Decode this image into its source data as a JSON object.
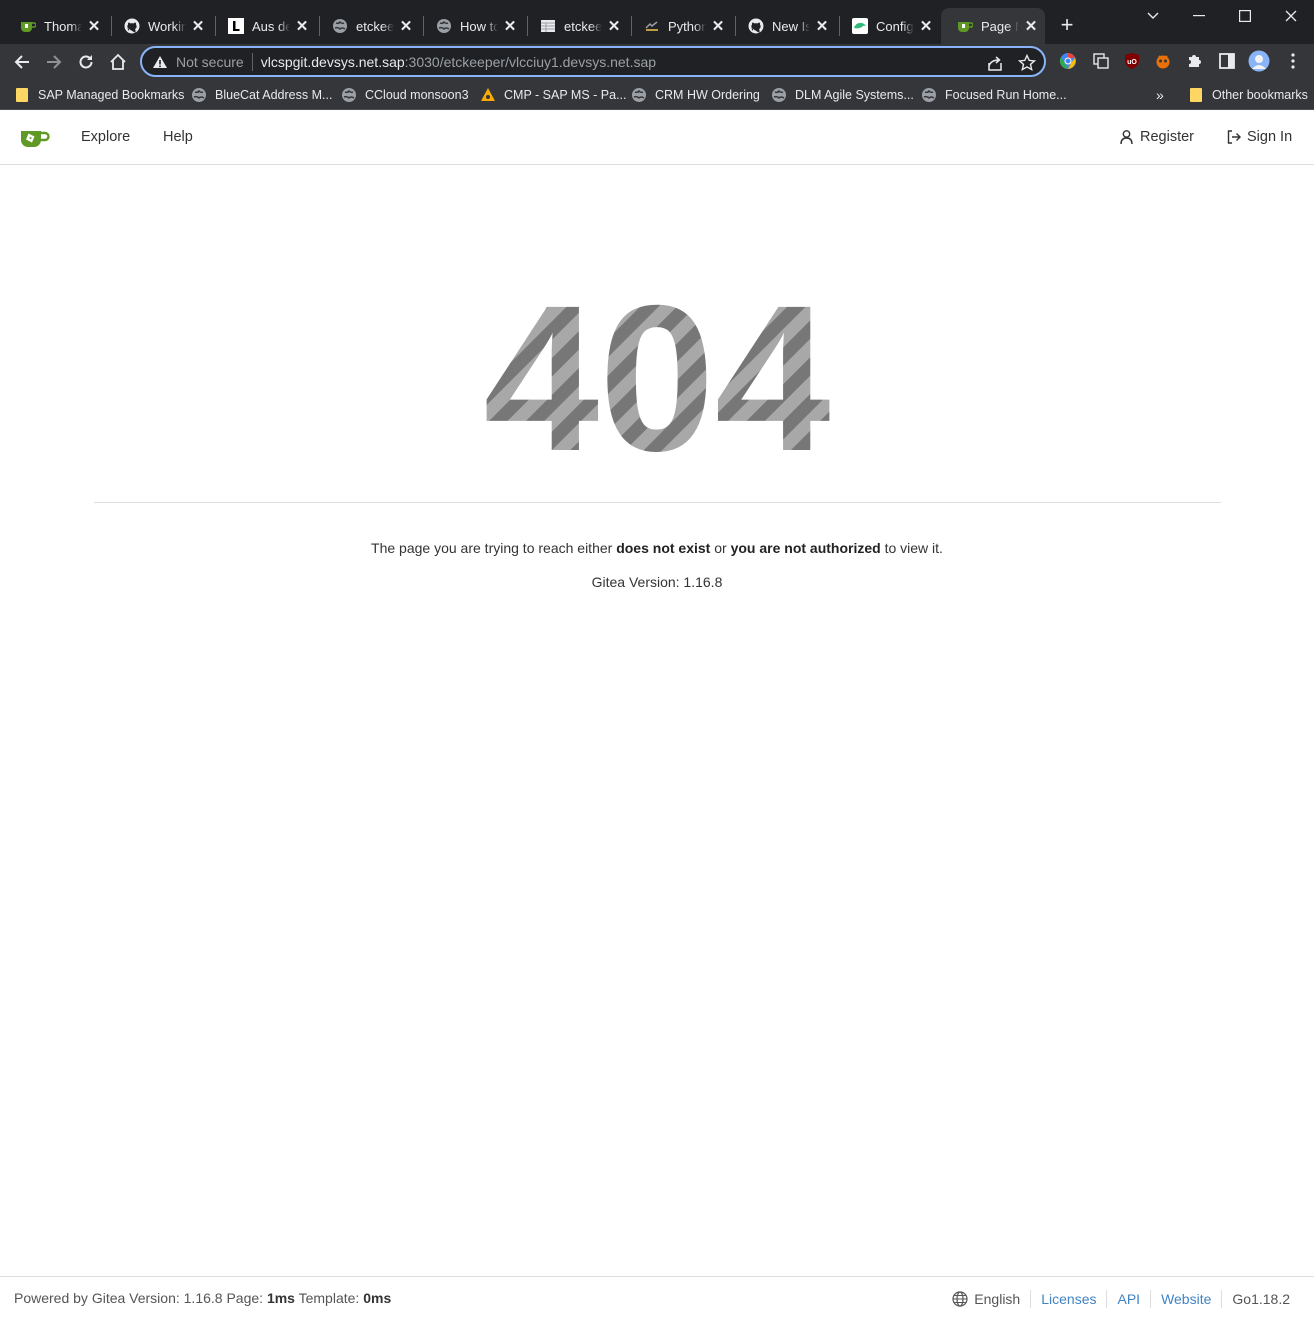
{
  "browser": {
    "tabs": [
      {
        "title": "Thomas",
        "icon": "gitea-icon"
      },
      {
        "title": "Working",
        "icon": "github-icon"
      },
      {
        "title": "Aus den",
        "icon": "l-letter-icon"
      },
      {
        "title": "etckeeper",
        "icon": "globe-icon"
      },
      {
        "title": "How to",
        "icon": "globe-icon"
      },
      {
        "title": "etckeeper",
        "icon": "document-icon"
      },
      {
        "title": "Python",
        "icon": "python-icon"
      },
      {
        "title": "New Issue",
        "icon": "github-icon"
      },
      {
        "title": "Configure",
        "icon": "suse-icon"
      },
      {
        "title": "Page Not Found",
        "icon": "gitea-icon",
        "active": true
      }
    ],
    "address": {
      "security_label": "Not secure",
      "host": "vlcspgit.devsys.net.sap",
      "path": ":3030/etckeeper/vlcciuy1.devsys.net.sap"
    },
    "bookmarks": [
      {
        "label": "SAP Managed Bookmarks",
        "icon": "folder-icon"
      },
      {
        "label": "BlueCat Address M...",
        "icon": "globe-icon"
      },
      {
        "label": "CCloud monsoon3",
        "icon": "globe-icon"
      },
      {
        "label": "CMP - SAP MS - Pa...",
        "icon": "cmp-icon"
      },
      {
        "label": "CRM HW Ordering",
        "icon": "globe-icon"
      },
      {
        "label": "DLM Agile Systems...",
        "icon": "globe-icon"
      },
      {
        "label": "Focused Run Home...",
        "icon": "globe-icon"
      }
    ],
    "overflow_label": "»",
    "other_bookmarks": "Other bookmarks",
    "colors": {
      "frame": "#202124",
      "toolbar": "#35363a",
      "focus": "#8ab4f8"
    }
  },
  "nav": {
    "explore": "Explore",
    "help": "Help",
    "register": "Register",
    "sign_in": "Sign In"
  },
  "error": {
    "code": "404",
    "message_pre": "The page you are trying to reach either ",
    "message_b1": "does not exist",
    "message_mid": " or ",
    "message_b2": "you are not authorized",
    "message_post": " to view it.",
    "version": "Gitea Version: 1.16.8"
  },
  "footer": {
    "powered_pre": "Powered by Gitea Version: 1.16.8 Page: ",
    "page_time": "1ms",
    "template_label": " Template: ",
    "template_time": "0ms",
    "language": "English",
    "licenses": "Licenses",
    "api": "API",
    "website": "Website",
    "go_version": "Go1.18.2",
    "link_color": "#4183c4"
  }
}
